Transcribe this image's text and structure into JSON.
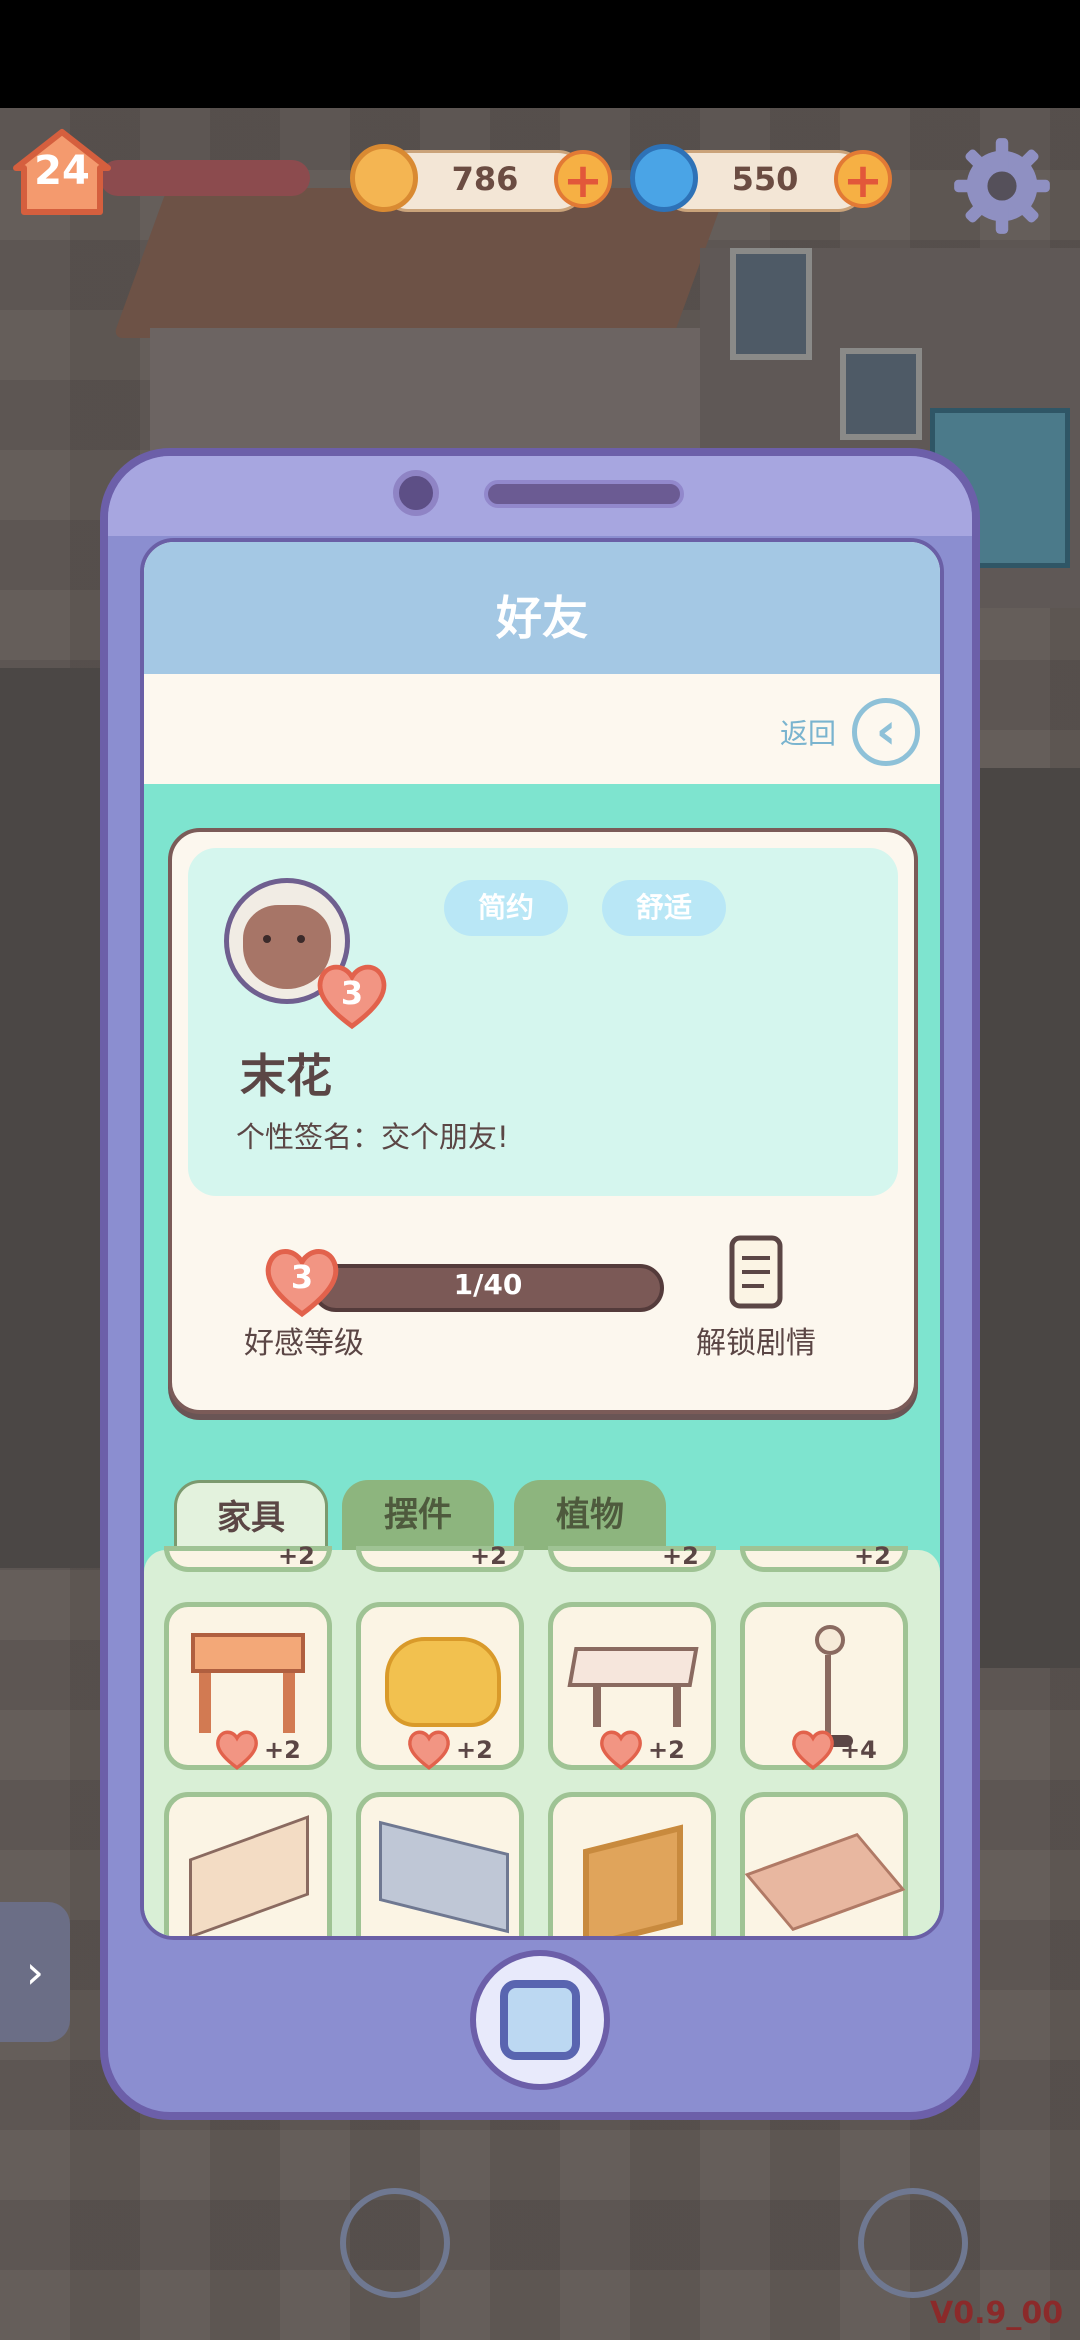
{
  "hud": {
    "level": "24",
    "coins": "786",
    "gems": "550",
    "add_label": "+",
    "settings_icon": "gear-icon"
  },
  "screen": {
    "title": "好友",
    "back_label": "返回",
    "back_icon": "‹"
  },
  "profile": {
    "tags": [
      "简约",
      "舒适"
    ],
    "name": "末花",
    "signature": "个性签名：交个朋友!",
    "heart_level": "3",
    "affinity_progress": "1/40",
    "affinity_label": "好感等级",
    "unlock_label": "解锁剧情"
  },
  "tabs": [
    "家具",
    "摆件",
    "植物"
  ],
  "items_row_partial": [
    {
      "bonus": "+2"
    },
    {
      "bonus": "+2"
    },
    {
      "bonus": "+2"
    },
    {
      "bonus": "+2"
    }
  ],
  "items_row1": [
    {
      "name": "wooden-stool",
      "bonus": "+2"
    },
    {
      "name": "yellow-ottoman",
      "bonus": "+2"
    },
    {
      "name": "white-low-table",
      "bonus": "+2"
    },
    {
      "name": "floor-lamp",
      "bonus": "+4"
    }
  ],
  "items_row2": [
    {
      "name": "staircase"
    },
    {
      "name": "bed"
    },
    {
      "name": "painting"
    },
    {
      "name": "rug"
    }
  ],
  "side_arrow": "›",
  "version": "V0.9_00"
}
